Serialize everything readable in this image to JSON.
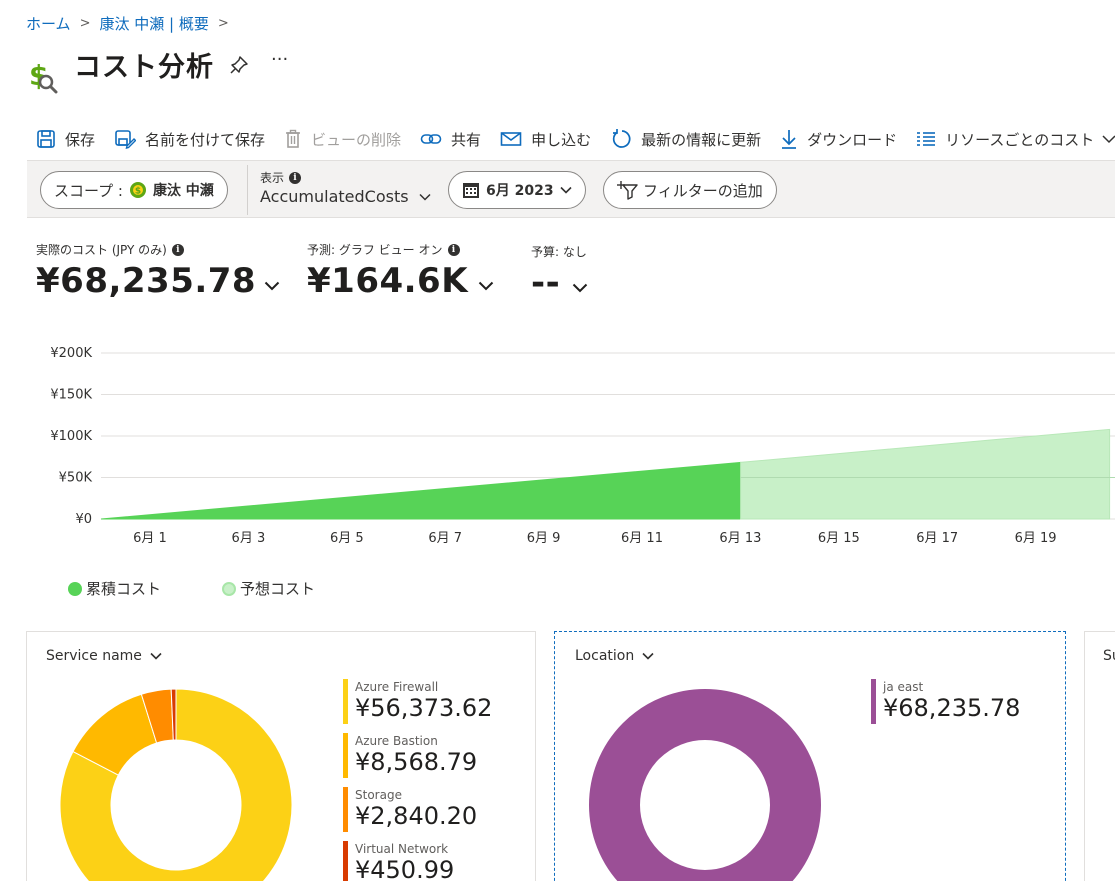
{
  "breadcrumb": [
    {
      "label": "ホーム"
    },
    {
      "label": "康汰 中瀬 | 概要"
    }
  ],
  "page": {
    "title": "コスト分析",
    "more": "···"
  },
  "toolbar": {
    "save": "保存",
    "save_as": "名前を付けて保存",
    "delete_view": "ビューの削除",
    "share": "共有",
    "subscribe": "申し込む",
    "refresh": "最新の情報に更新",
    "download": "ダウンロード",
    "group_by": "リソースごとのコスト"
  },
  "filters": {
    "scope_label": "スコープ :",
    "scope_value": "康汰 中瀬",
    "view_label": "表示",
    "view_value": "AccumulatedCosts",
    "date": "6月 2023",
    "add_filter": "フィルターの追加"
  },
  "kpis": {
    "actual_label": "実際のコスト (JPY のみ)",
    "actual_value": "¥68,235.78",
    "forecast_label": "予測: グラフ ビュー オン",
    "forecast_value": "¥164.6K",
    "budget_label": "予算: なし",
    "budget_value": "--"
  },
  "colors": {
    "actual": "#57d357",
    "forecast": "#c8f0c8",
    "accent": "#0f6cbd",
    "azure_firewall": "#fcd116",
    "azure_bastion": "#ffb900",
    "storage": "#ff8c00",
    "virtual_network": "#d83b01",
    "ja_east": "#9b4f96"
  },
  "chart_data": {
    "type": "area",
    "y_ticks": [
      "¥200K",
      "¥150K",
      "¥100K",
      "¥50K",
      "¥0"
    ],
    "ylim": [
      0,
      200000
    ],
    "x_ticks": [
      "6月 1",
      "6月 3",
      "6月 5",
      "6月 7",
      "6月 9",
      "6月 11",
      "6月 13",
      "6月 15",
      "6月 17",
      "6月 19"
    ],
    "xlim": [
      1,
      21
    ],
    "series": [
      {
        "name": "累積コスト",
        "x": [
          1,
          14
        ],
        "y": [
          0,
          68235.78
        ]
      },
      {
        "name": "予想コスト",
        "x": [
          14,
          21.5
        ],
        "y": [
          68235.78,
          108000
        ]
      }
    ],
    "legend": [
      "累積コスト",
      "予想コスト"
    ]
  },
  "cards": {
    "service": {
      "header": "Service name",
      "items": [
        {
          "name": "Azure Firewall",
          "value": "¥56,373.62",
          "amount": 56373.62
        },
        {
          "name": "Azure Bastion",
          "value": "¥8,568.79",
          "amount": 8568.79
        },
        {
          "name": "Storage",
          "value": "¥2,840.20",
          "amount": 2840.2
        },
        {
          "name": "Virtual Network",
          "value": "¥450.99",
          "amount": 450.99
        }
      ]
    },
    "location": {
      "header": "Location",
      "items": [
        {
          "name": "ja east",
          "value": "¥68,235.78",
          "amount": 68235.78
        }
      ]
    },
    "third": {
      "header": "Su"
    }
  }
}
